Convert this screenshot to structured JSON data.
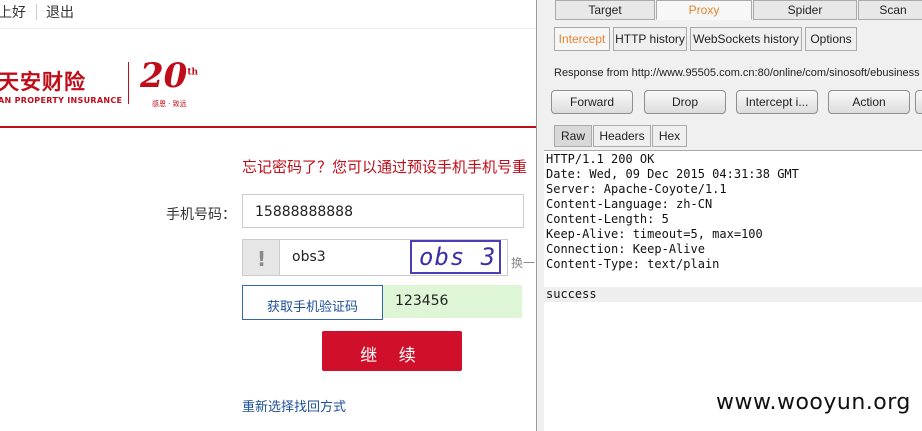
{
  "topbar": {
    "greeting": "上好",
    "logout": "退出"
  },
  "logo": {
    "name_cn": "天安财险",
    "name_en": "AN PROPERTY INSURANCE",
    "anniversary": "20",
    "anniversary_suffix": "th",
    "tagline": "感恩 · 致远",
    "brand_color": "#c00d1a"
  },
  "form": {
    "forgot_text": "忘记密码了？您可以通过预设手机手机号重",
    "phone_label": "手机号码：",
    "phone_value": "15888888888",
    "captcha_icon": "!",
    "captcha_value": "obs3",
    "captcha_image_text": "obs 3",
    "captcha_swap": "换一",
    "sms_button": "获取手机验证码",
    "sms_code_value": "123456",
    "continue_button": "继  续",
    "reselect_link": "重新选择找回方式"
  },
  "burp": {
    "main_tabs": [
      "Target",
      "Proxy",
      "Spider",
      "Scan"
    ],
    "active_main_tab": "Proxy",
    "proxy_tabs": [
      "Intercept",
      "HTTP history",
      "WebSockets history",
      "Options"
    ],
    "active_proxy_tab": "Intercept",
    "response_from": "Response from http://www.95505.com.cn:80/online/com/sinosoft/ebusiness",
    "buttons": {
      "forward": "Forward",
      "drop": "Drop",
      "intercept": "Intercept i...",
      "action": "Action"
    },
    "view_tabs": [
      "Raw",
      "Headers",
      "Hex"
    ],
    "active_view_tab": "Raw",
    "raw_lines": [
      "HTTP/1.1 200 OK",
      "Date: Wed, 09 Dec 2015 04:31:38 GMT",
      "Server: Apache-Coyote/1.1",
      "Content-Language: zh-CN",
      "Content-Length: 5",
      "Keep-Alive: timeout=5, max=100",
      "Connection: Keep-Alive",
      "Content-Type: text/plain",
      "",
      "success"
    ],
    "accent_color": "#e8832e"
  },
  "watermark": "www.wooyun.org"
}
